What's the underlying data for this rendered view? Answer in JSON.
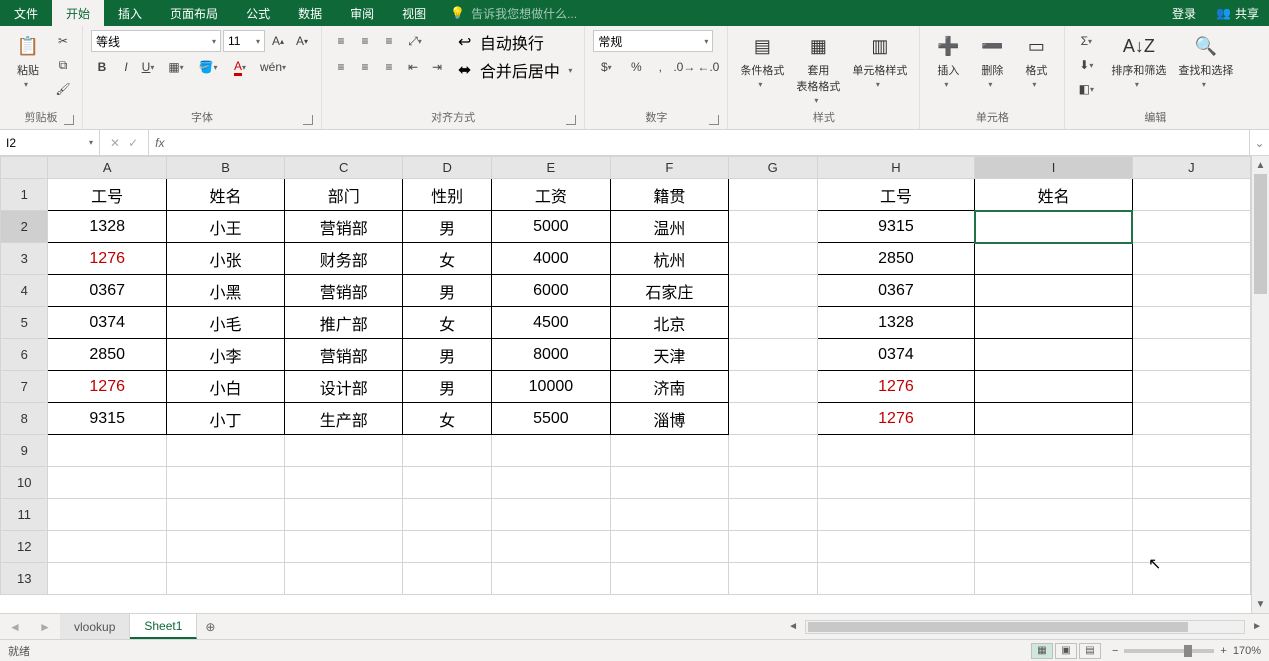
{
  "menu": {
    "file": "文件",
    "tabs": [
      "开始",
      "插入",
      "页面布局",
      "公式",
      "数据",
      "审阅",
      "视图"
    ],
    "active_tab": 0,
    "tellme_placeholder": "告诉我您想做什么...",
    "login": "登录",
    "share": "共享"
  },
  "ribbon": {
    "clipboard": {
      "paste": "粘贴",
      "label": "剪贴板"
    },
    "font": {
      "name": "等线",
      "size": "11",
      "label": "字体"
    },
    "align": {
      "wrap": "自动换行",
      "merge": "合并后居中",
      "label": "对齐方式"
    },
    "number": {
      "format": "常规",
      "label": "数字"
    },
    "styles": {
      "cond": "条件格式",
      "table": "套用\n表格格式",
      "cell": "单元格样式",
      "label": "样式"
    },
    "cells": {
      "insert": "插入",
      "delete": "删除",
      "format": "格式",
      "label": "单元格"
    },
    "editing": {
      "sort": "排序和筛选",
      "find": "查找和选择",
      "label": "编辑"
    }
  },
  "namebox": "I2",
  "formula": "",
  "columns": [
    "A",
    "B",
    "C",
    "D",
    "E",
    "F",
    "G",
    "H",
    "I",
    "J"
  ],
  "rows_shown": 13,
  "active_col_index": 8,
  "active_row_index": 1,
  "table_left": {
    "headers": [
      "工号",
      "姓名",
      "部门",
      "性别",
      "工资",
      "籍贯"
    ],
    "rows": [
      {
        "r": false,
        "c": [
          "1328",
          "小王",
          "营销部",
          "男",
          "5000",
          "温州"
        ]
      },
      {
        "r": true,
        "c": [
          "1276",
          "小张",
          "财务部",
          "女",
          "4000",
          "杭州"
        ]
      },
      {
        "r": false,
        "c": [
          "0367",
          "小黑",
          "营销部",
          "男",
          "6000",
          "石家庄"
        ]
      },
      {
        "r": false,
        "c": [
          "0374",
          "小毛",
          "推广部",
          "女",
          "4500",
          "北京"
        ]
      },
      {
        "r": false,
        "c": [
          "2850",
          "小李",
          "营销部",
          "男",
          "8000",
          "天津"
        ]
      },
      {
        "r": true,
        "c": [
          "1276",
          "小白",
          "设计部",
          "男",
          "10000",
          "济南"
        ]
      },
      {
        "r": false,
        "c": [
          "9315",
          "小丁",
          "生产部",
          "女",
          "5500",
          "淄博"
        ]
      }
    ]
  },
  "table_right": {
    "headers": [
      "工号",
      "姓名"
    ],
    "rows": [
      {
        "r": false,
        "v": "9315"
      },
      {
        "r": false,
        "v": "2850"
      },
      {
        "r": false,
        "v": "0367"
      },
      {
        "r": false,
        "v": "1328"
      },
      {
        "r": false,
        "v": "0374"
      },
      {
        "r": true,
        "v": "1276"
      },
      {
        "r": true,
        "v": "1276"
      }
    ]
  },
  "sheets": {
    "tabs": [
      "vlookup",
      "Sheet1"
    ],
    "active": 1
  },
  "status": {
    "ready": "就绪",
    "zoom": "170%"
  }
}
